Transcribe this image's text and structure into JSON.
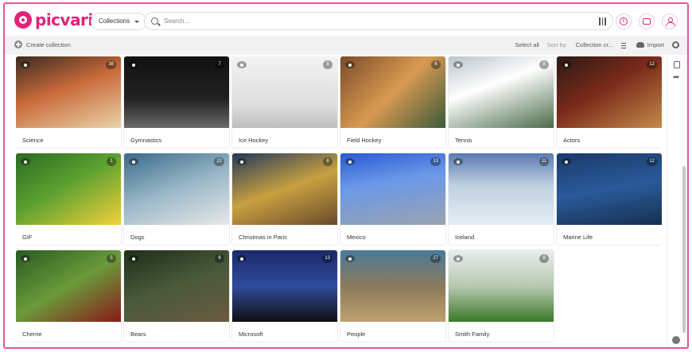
{
  "brand": {
    "name": "picvario",
    "color": "#e8207a"
  },
  "header": {
    "collections_label": "Collections",
    "search_placeholder": "Search...",
    "icons": [
      "filter-icon",
      "info-icon",
      "inbox-icon",
      "user-icon"
    ]
  },
  "toolbar": {
    "create_label": "Create collection",
    "select_all": "Select all",
    "sort_by": "Sort by:",
    "sort_value": "Collection cr...",
    "import_label": "Import"
  },
  "collections": [
    {
      "name": "Science",
      "count": "38"
    },
    {
      "name": "Gymnastics",
      "count": "7"
    },
    {
      "name": "Ice Hockey",
      "count": "8"
    },
    {
      "name": "Field Hockey",
      "count": "6"
    },
    {
      "name": "Tennis",
      "count": "8"
    },
    {
      "name": "Actors",
      "count": "12"
    },
    {
      "name": "GIF",
      "count": "1"
    },
    {
      "name": "Dogs",
      "count": "22"
    },
    {
      "name": "Christmas in Paris",
      "count": "8"
    },
    {
      "name": "Mexico",
      "count": "13"
    },
    {
      "name": "Iceland",
      "count": "11"
    },
    {
      "name": "Marine Life",
      "count": "12"
    },
    {
      "name": "Cherrie",
      "count": "5"
    },
    {
      "name": "Bears",
      "count": "6"
    },
    {
      "name": "Microsoft",
      "count": "13"
    },
    {
      "name": "People",
      "count": "27"
    },
    {
      "name": "Smith Family",
      "count": "8"
    }
  ]
}
